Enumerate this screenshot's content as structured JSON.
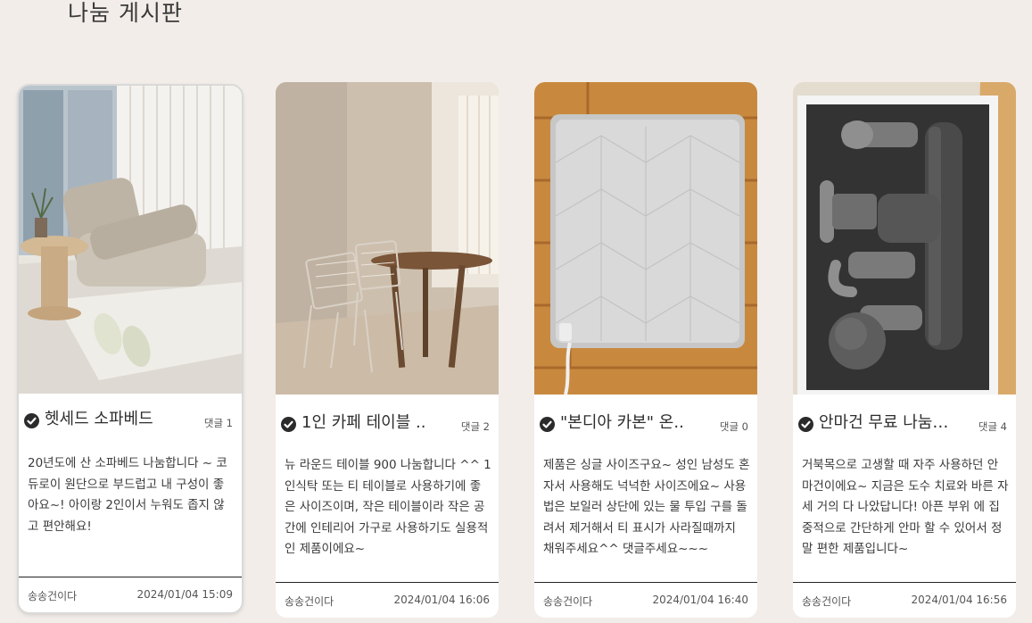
{
  "page": {
    "title": "나눔 게시판"
  },
  "colors": {
    "background": "#f2ede8",
    "card": "#ffffff",
    "check": "#2b2b2b"
  },
  "posts": [
    {
      "title": "헷세드 소파베드",
      "comments": "댓글 1",
      "body": "20년도에 산 소파베드 나눔합니다 ~ 코듀로이 원단으로 부드럽고 내 구성이 좋아요~! 아이랑 2인이서 누워도 좁지 않고 편안해요!",
      "author": "송송건이다",
      "date": "2024/01/04 15:09",
      "image_icon": "sofa-bed-photo"
    },
    {
      "title": "1인 카페 테이블 ..",
      "comments": "댓글 2",
      "body": "뉴 라운드 테이블 900 나눔합니다 ^^ 1인식탁 또는 티 테이블로 사용하기에 좋은 사이즈이며, 작은 테이블이라 작은 공간에 인테리어 가구로 사용하기도 실용적인 제품이에요~",
      "author": "송송건이다",
      "date": "2024/01/04 16:06",
      "image_icon": "cafe-table-photo"
    },
    {
      "title": "\"본디아 카본\" 온..",
      "comments": "댓글 0",
      "body": "제품은 싱글 사이즈구요~ 성인 남성도 혼자서 사용해도 넉넉한 사이즈에요~ 사용법은 보일러 상단에 있는 물 투입 구를 돌려서 제거해서 티 표시가 사라질때까지 채워주세요^^ 댓글주세요~~~",
      "author": "송송건이다",
      "date": "2024/01/04 16:40",
      "image_icon": "heating-mat-photo"
    },
    {
      "title": "안마건 무료 나눔합..",
      "comments": "댓글 4",
      "body": "거북목으로 고생할 때 자주 사용하던 안마건이에요~ 지금은 도수 치료와 바른 자세 거의 다 나았답니다! 아픈 부위 에 집중적으로 간단하게 안마 할 수 있어서 정말 편한 제품입니다~",
      "author": "송송건이다",
      "date": "2024/01/04 16:56",
      "image_icon": "massage-gun-photo"
    }
  ]
}
